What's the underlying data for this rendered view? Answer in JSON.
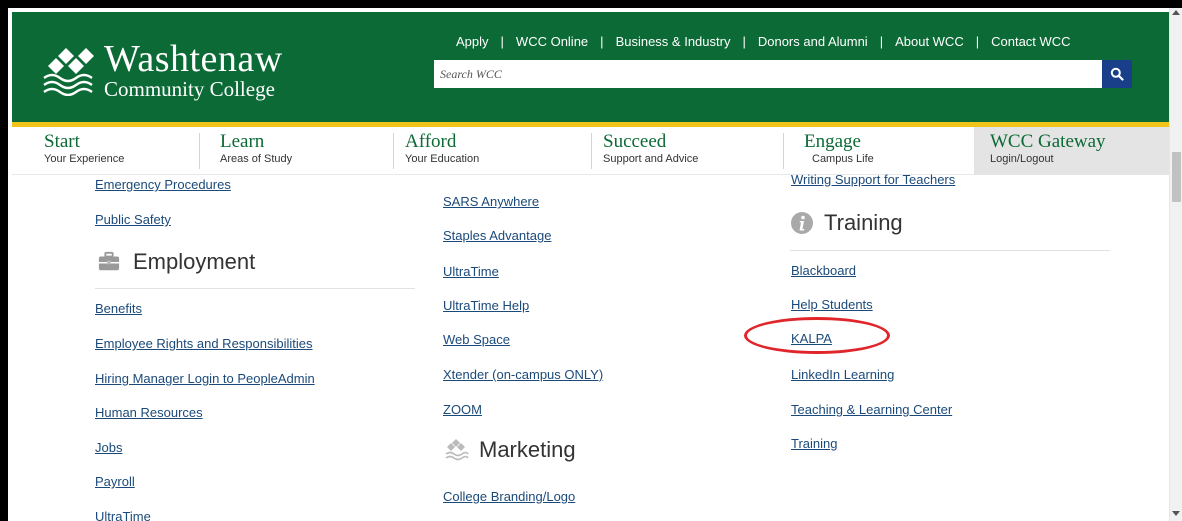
{
  "college": {
    "name": "Washtenaw",
    "subname": "Community College"
  },
  "utility_nav": [
    "Apply",
    "WCC Online",
    "Business & Industry",
    "Donors and Alumni",
    "About WCC",
    "Contact WCC"
  ],
  "search": {
    "placeholder": "Search WCC",
    "icon": "search-icon"
  },
  "main_nav": [
    {
      "title": "Start",
      "subtitle": "Your Experience"
    },
    {
      "title": "Learn",
      "subtitle": "Areas of Study"
    },
    {
      "title": "Afford",
      "subtitle": "Your Education"
    },
    {
      "title": "Succeed",
      "subtitle": "Support and Advice"
    },
    {
      "title": "Engage",
      "subtitle": "Campus Life"
    },
    {
      "title": "WCC Gateway",
      "subtitle": "Login/Logout"
    }
  ],
  "col1": {
    "top_links": [
      "Emergency Procedures",
      "Public Safety"
    ],
    "employment": {
      "heading": "Employment",
      "icon": "briefcase-icon",
      "links": [
        "Benefits",
        "Employee Rights and Responsibilities",
        "Hiring Manager Login to PeopleAdmin",
        "Human Resources",
        "Jobs",
        "Payroll",
        "UltraTime"
      ]
    }
  },
  "col2": {
    "links": [
      "SARS Anywhere",
      "Staples Advantage",
      "UltraTime",
      "UltraTime Help",
      "Web Space",
      "Xtender (on-campus ONLY)",
      "ZOOM"
    ],
    "marketing": {
      "heading": "Marketing",
      "icon": "wcc-logo-icon",
      "links": [
        "College Branding/Logo"
      ]
    }
  },
  "col3": {
    "top_links": [
      "Writing Support for Teachers"
    ],
    "training": {
      "heading": "Training",
      "icon": "info-icon",
      "links": [
        "Blackboard",
        "Help Students",
        "KALPA",
        "LinkedIn Learning",
        "Teaching & Learning Center",
        "Training"
      ]
    }
  },
  "colors": {
    "brand_green": "#0b6a35",
    "accent_gold": "#f0c419",
    "link_blue": "#1b4a7a",
    "search_button": "#1a3f8a",
    "annotation_red": "#e0262a"
  }
}
